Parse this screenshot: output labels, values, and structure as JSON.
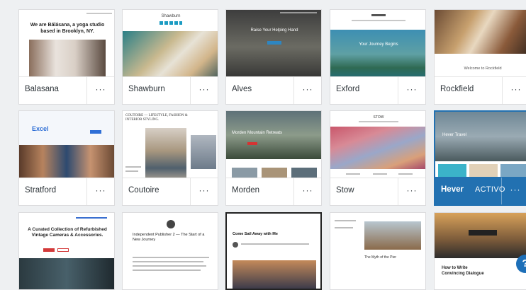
{
  "themes": [
    {
      "name": "Balasana",
      "headline": "We are Bálásana, a yoga studio based in Brooklyn, NY."
    },
    {
      "name": "Shawburn",
      "headline": "Shawburn"
    },
    {
      "name": "Alves",
      "headline": "Raise Your Helping Hand"
    },
    {
      "name": "Exford",
      "headline": "Your Journey Begins"
    },
    {
      "name": "Rockfield",
      "headline": "Welcome to Rockfield"
    },
    {
      "name": "Stratford",
      "headline": "Excel"
    },
    {
      "name": "Coutoire",
      "headline": "COUTOIRE — LIFESTYLE, FASHION & INTERIOR STYLING."
    },
    {
      "name": "Morden",
      "headline": "Morden Mountain Retreats"
    },
    {
      "name": "Stow",
      "headline": "STOW"
    },
    {
      "name": "Hever",
      "headline": "Hever Travel",
      "badge": "ACTIVO"
    },
    {
      "name": "",
      "headline": "A Curated Collection of Refurbished Vintage Cameras & Accessories."
    },
    {
      "name": "",
      "headline": "Independent Publisher 2 — The Start of a New Journey"
    },
    {
      "name": "",
      "headline": "Come Sail Away with Me"
    },
    {
      "name": "",
      "headline": "The Myth of the Pier"
    },
    {
      "name": "",
      "headline": "How to Write Convincing Dialogue"
    }
  ],
  "menu_label": "···",
  "help_label": "?",
  "colors": {
    "accent": "#2271b1",
    "help": "#1d6fb8"
  }
}
